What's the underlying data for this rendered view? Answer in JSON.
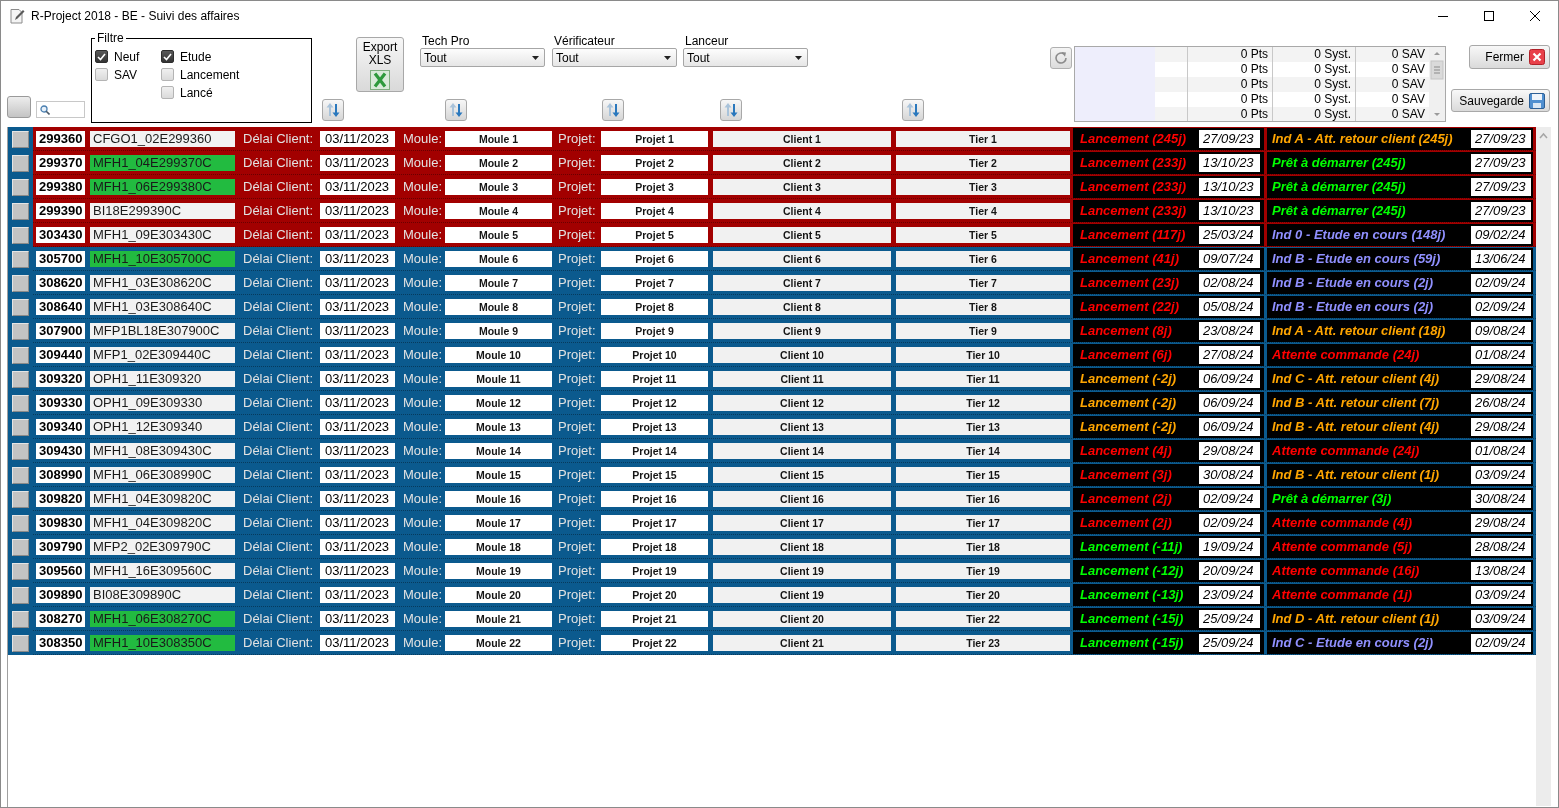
{
  "window": {
    "title": "R-Project 2018 - BE - Suivi des affaires"
  },
  "filter": {
    "title": "Filtre",
    "columns": [
      {
        "options": [
          {
            "label": "Neuf",
            "checked": true
          },
          {
            "label": "SAV",
            "checked": false
          }
        ]
      },
      {
        "options": [
          {
            "label": "Etude",
            "checked": true
          },
          {
            "label": "Lancement",
            "checked": false
          },
          {
            "label": "Lancé",
            "checked": false
          }
        ]
      }
    ]
  },
  "export_button": {
    "label": "Export XLS"
  },
  "dropdowns": [
    {
      "label": "Tech Pro",
      "value": "Tout"
    },
    {
      "label": "Vérificateur",
      "value": "Tout"
    },
    {
      "label": "Lanceur",
      "value": "Tout"
    }
  ],
  "summary": {
    "rows": [
      {
        "points": "0 Pts",
        "system": "0 Syst.",
        "sav": "0 SAV"
      },
      {
        "points": "0 Pts",
        "system": "0 Syst.",
        "sav": "0 SAV"
      },
      {
        "points": "0 Pts",
        "system": "0 Syst.",
        "sav": "0 SAV"
      },
      {
        "points": "0 Pts",
        "system": "0 Syst.",
        "sav": "0 SAV"
      },
      {
        "points": "0 Pts",
        "system": "0 Syst.",
        "sav": "0 SAV"
      }
    ]
  },
  "buttons": [
    {
      "kind": "close",
      "label": "Fermer"
    },
    {
      "kind": "save",
      "label": "Sauvegarde"
    }
  ],
  "rows": [
    {
      "id": "299360",
      "code": "CFGO1_02E299360",
      "code_marked": false,
      "flagged": true,
      "delai_label": "Délai Client:",
      "delai": "03/11/2023",
      "moule_label": "Moule:",
      "moule": "Moule 1",
      "projet_label": "Projet:",
      "projet": "Projet 1",
      "client": "Client 1",
      "tier": "Tier 1",
      "launch": {
        "text": "Lancement (245j)",
        "color": "#ff0000",
        "date": "27/09/23"
      },
      "status": {
        "text": "Ind A - Att. retour client (245j)",
        "color": "#ffa500",
        "date": "27/09/23"
      }
    },
    {
      "id": "299370",
      "code": "MFH1_04E299370C",
      "code_marked": true,
      "flagged": true,
      "delai_label": "Délai Client:",
      "delai": "03/11/2023",
      "moule_label": "Moule:",
      "moule": "Moule 2",
      "projet_label": "Projet:",
      "projet": "Projet 2",
      "client": "Client 2",
      "tier": "Tier 2",
      "launch": {
        "text": "Lancement (233j)",
        "color": "#ff0000",
        "date": "13/10/23"
      },
      "status": {
        "text": "Prêt à démarrer (245j)",
        "color": "#00ff00",
        "date": "27/09/23"
      }
    },
    {
      "id": "299380",
      "code": "MFH1_06E299380C",
      "code_marked": true,
      "flagged": true,
      "delai_label": "Délai Client:",
      "delai": "03/11/2023",
      "moule_label": "Moule:",
      "moule": "Moule 3",
      "projet_label": "Projet:",
      "projet": "Projet 3",
      "client": "Client 3",
      "tier": "Tier 3",
      "launch": {
        "text": "Lancement (233j)",
        "color": "#ff0000",
        "date": "13/10/23"
      },
      "status": {
        "text": "Prêt à démarrer (245j)",
        "color": "#00ff00",
        "date": "27/09/23"
      }
    },
    {
      "id": "299390",
      "code": "BI18E299390C",
      "code_marked": false,
      "flagged": true,
      "delai_label": "Délai Client:",
      "delai": "03/11/2023",
      "moule_label": "Moule:",
      "moule": "Moule 4",
      "projet_label": "Projet:",
      "projet": "Projet 4",
      "client": "Client 4",
      "tier": "Tier 4",
      "launch": {
        "text": "Lancement (233j)",
        "color": "#ff0000",
        "date": "13/10/23"
      },
      "status": {
        "text": "Prêt à démarrer (245j)",
        "color": "#00ff00",
        "date": "27/09/23"
      }
    },
    {
      "id": "303430",
      "code": "MFH1_09E303430C",
      "code_marked": false,
      "flagged": true,
      "delai_label": "Délai Client:",
      "delai": "03/11/2023",
      "moule_label": "Moule:",
      "moule": "Moule 5",
      "projet_label": "Projet:",
      "projet": "Projet 5",
      "client": "Client 5",
      "tier": "Tier 5",
      "launch": {
        "text": "Lancement (117j)",
        "color": "#ff0000",
        "date": "25/03/24"
      },
      "status": {
        "text": "Ind 0 - Etude en cours (148j)",
        "color": "#9090ff",
        "date": "09/02/24"
      }
    },
    {
      "id": "305700",
      "code": "MFH1_10E305700C",
      "code_marked": true,
      "flagged": false,
      "delai_label": "Délai Client:",
      "delai": "03/11/2023",
      "moule_label": "Moule:",
      "moule": "Moule 6",
      "projet_label": "Projet:",
      "projet": "Projet 6",
      "client": "Client 6",
      "tier": "Tier 6",
      "launch": {
        "text": "Lancement (41j)",
        "color": "#ff0000",
        "date": "09/07/24"
      },
      "status": {
        "text": "Ind B - Etude en cours (59j)",
        "color": "#9090ff",
        "date": "13/06/24"
      }
    },
    {
      "id": "308620",
      "code": "MFH1_03E308620C",
      "code_marked": false,
      "flagged": false,
      "delai_label": "Délai Client:",
      "delai": "03/11/2023",
      "moule_label": "Moule:",
      "moule": "Moule 7",
      "projet_label": "Projet:",
      "projet": "Projet 7",
      "client": "Client 7",
      "tier": "Tier 7",
      "launch": {
        "text": "Lancement (23j)",
        "color": "#ff0000",
        "date": "02/08/24"
      },
      "status": {
        "text": "Ind B - Etude en cours (2j)",
        "color": "#9090ff",
        "date": "02/09/24"
      }
    },
    {
      "id": "308640",
      "code": "MFH1_03E308640C",
      "code_marked": false,
      "flagged": false,
      "delai_label": "Délai Client:",
      "delai": "03/11/2023",
      "moule_label": "Moule:",
      "moule": "Moule 8",
      "projet_label": "Projet:",
      "projet": "Projet 8",
      "client": "Client 8",
      "tier": "Tier 8",
      "launch": {
        "text": "Lancement (22j)",
        "color": "#ff0000",
        "date": "05/08/24"
      },
      "status": {
        "text": "Ind B - Etude en cours (2j)",
        "color": "#9090ff",
        "date": "02/09/24"
      }
    },
    {
      "id": "307900",
      "code": "MFP1BL18E307900C",
      "code_marked": false,
      "flagged": false,
      "delai_label": "Délai Client:",
      "delai": "03/11/2023",
      "moule_label": "Moule:",
      "moule": "Moule 9",
      "projet_label": "Projet:",
      "projet": "Projet 9",
      "client": "Client 9",
      "tier": "Tier 9",
      "launch": {
        "text": "Lancement (8j)",
        "color": "#ff0000",
        "date": "23/08/24"
      },
      "status": {
        "text": "Ind A - Att. retour client (18j)",
        "color": "#ffa500",
        "date": "09/08/24"
      }
    },
    {
      "id": "309440",
      "code": "MFP1_02E309440C",
      "code_marked": false,
      "flagged": false,
      "delai_label": "Délai Client:",
      "delai": "03/11/2023",
      "moule_label": "Moule:",
      "moule": "Moule 10",
      "projet_label": "Projet:",
      "projet": "Projet 10",
      "client": "Client 10",
      "tier": "Tier 10",
      "launch": {
        "text": "Lancement (6j)",
        "color": "#ff0000",
        "date": "27/08/24"
      },
      "status": {
        "text": "Attente commande (24j)",
        "color": "#ff0000",
        "date": "01/08/24"
      }
    },
    {
      "id": "309320",
      "code": "OPH1_11E309320",
      "code_marked": false,
      "flagged": false,
      "delai_label": "Délai Client:",
      "delai": "03/11/2023",
      "moule_label": "Moule:",
      "moule": "Moule 11",
      "projet_label": "Projet:",
      "projet": "Projet 11",
      "client": "Client 11",
      "tier": "Tier 11",
      "launch": {
        "text": "Lancement (-2j)",
        "color": "#ffa500",
        "date": "06/09/24"
      },
      "status": {
        "text": "Ind C - Att. retour client (4j)",
        "color": "#ffa500",
        "date": "29/08/24"
      }
    },
    {
      "id": "309330",
      "code": "OPH1_09E309330",
      "code_marked": false,
      "flagged": false,
      "delai_label": "Délai Client:",
      "delai": "03/11/2023",
      "moule_label": "Moule:",
      "moule": "Moule 12",
      "projet_label": "Projet:",
      "projet": "Projet 12",
      "client": "Client 12",
      "tier": "Tier 12",
      "launch": {
        "text": "Lancement (-2j)",
        "color": "#ffa500",
        "date": "06/09/24"
      },
      "status": {
        "text": "Ind B - Att. retour client (7j)",
        "color": "#ffa500",
        "date": "26/08/24"
      }
    },
    {
      "id": "309340",
      "code": "OPH1_12E309340",
      "code_marked": false,
      "flagged": false,
      "delai_label": "Délai Client:",
      "delai": "03/11/2023",
      "moule_label": "Moule:",
      "moule": "Moule 13",
      "projet_label": "Projet:",
      "projet": "Projet 13",
      "client": "Client 13",
      "tier": "Tier 13",
      "launch": {
        "text": "Lancement (-2j)",
        "color": "#ffa500",
        "date": "06/09/24"
      },
      "status": {
        "text": "Ind B - Att. retour client (4j)",
        "color": "#ffa500",
        "date": "29/08/24"
      }
    },
    {
      "id": "309430",
      "code": "MFH1_08E309430C",
      "code_marked": false,
      "flagged": false,
      "delai_label": "Délai Client:",
      "delai": "03/11/2023",
      "moule_label": "Moule:",
      "moule": "Moule 14",
      "projet_label": "Projet:",
      "projet": "Projet 14",
      "client": "Client 14",
      "tier": "Tier 14",
      "launch": {
        "text": "Lancement (4j)",
        "color": "#ff0000",
        "date": "29/08/24"
      },
      "status": {
        "text": "Attente commande (24j)",
        "color": "#ff0000",
        "date": "01/08/24"
      }
    },
    {
      "id": "308990",
      "code": "MFH1_06E308990C",
      "code_marked": false,
      "flagged": false,
      "delai_label": "Délai Client:",
      "delai": "03/11/2023",
      "moule_label": "Moule:",
      "moule": "Moule 15",
      "projet_label": "Projet:",
      "projet": "Projet 15",
      "client": "Client 15",
      "tier": "Tier 15",
      "launch": {
        "text": "Lancement (3j)",
        "color": "#ff0000",
        "date": "30/08/24"
      },
      "status": {
        "text": "Ind B - Att. retour client (1j)",
        "color": "#ffa500",
        "date": "03/09/24"
      }
    },
    {
      "id": "309820",
      "code": "MFH1_04E309820C",
      "code_marked": false,
      "flagged": false,
      "delai_label": "Délai Client:",
      "delai": "03/11/2023",
      "moule_label": "Moule:",
      "moule": "Moule 16",
      "projet_label": "Projet:",
      "projet": "Projet 16",
      "client": "Client 16",
      "tier": "Tier 16",
      "launch": {
        "text": "Lancement (2j)",
        "color": "#ff0000",
        "date": "02/09/24"
      },
      "status": {
        "text": "Prêt à démarrer (3j)",
        "color": "#00ff00",
        "date": "30/08/24"
      }
    },
    {
      "id": "309830",
      "code": "MFH1_04E309820C",
      "code_marked": false,
      "flagged": false,
      "delai_label": "Délai Client:",
      "delai": "03/11/2023",
      "moule_label": "Moule:",
      "moule": "Moule 17",
      "projet_label": "Projet:",
      "projet": "Projet 17",
      "client": "Client 17",
      "tier": "Tier 17",
      "launch": {
        "text": "Lancement (2j)",
        "color": "#ff0000",
        "date": "02/09/24"
      },
      "status": {
        "text": "Attente commande (4j)",
        "color": "#ff0000",
        "date": "29/08/24"
      }
    },
    {
      "id": "309790",
      "code": "MFP2_02E309790C",
      "code_marked": false,
      "flagged": false,
      "delai_label": "Délai Client:",
      "delai": "03/11/2023",
      "moule_label": "Moule:",
      "moule": "Moule 18",
      "projet_label": "Projet:",
      "projet": "Projet 18",
      "client": "Client 18",
      "tier": "Tier 18",
      "launch": {
        "text": "Lancement (-11j)",
        "color": "#00ff00",
        "date": "19/09/24"
      },
      "status": {
        "text": "Attente commande (5j)",
        "color": "#ff0000",
        "date": "28/08/24"
      }
    },
    {
      "id": "309560",
      "code": "MFH1_16E309560C",
      "code_marked": false,
      "flagged": false,
      "delai_label": "Délai Client:",
      "delai": "03/11/2023",
      "moule_label": "Moule:",
      "moule": "Moule 19",
      "projet_label": "Projet:",
      "projet": "Projet 19",
      "client": "Client 19",
      "tier": "Tier 19",
      "launch": {
        "text": "Lancement (-12j)",
        "color": "#00ff00",
        "date": "20/09/24"
      },
      "status": {
        "text": "Attente commande (16j)",
        "color": "#ff0000",
        "date": "13/08/24"
      }
    },
    {
      "id": "309890",
      "code": "BI08E309890C",
      "code_marked": false,
      "flagged": false,
      "delai_label": "Délai Client:",
      "delai": "03/11/2023",
      "moule_label": "Moule:",
      "moule": "Moule 20",
      "projet_label": "Projet:",
      "projet": "Projet 20",
      "client": "Client 19",
      "tier": "Tier 20",
      "launch": {
        "text": "Lancement (-13j)",
        "color": "#00ff00",
        "date": "23/09/24"
      },
      "status": {
        "text": "Attente commande (1j)",
        "color": "#ff0000",
        "date": "03/09/24"
      }
    },
    {
      "id": "308270",
      "code": "MFH1_06E308270C",
      "code_marked": true,
      "flagged": false,
      "delai_label": "Délai Client:",
      "delai": "03/11/2023",
      "moule_label": "Moule:",
      "moule": "Moule 21",
      "projet_label": "Projet:",
      "projet": "Projet 21",
      "client": "Client 20",
      "tier": "Tier 22",
      "launch": {
        "text": "Lancement (-15j)",
        "color": "#00ff00",
        "date": "25/09/24"
      },
      "status": {
        "text": "Ind D - Att. retour client (1j)",
        "color": "#ffa500",
        "date": "03/09/24"
      }
    },
    {
      "id": "308350",
      "code": "MFH1_10E308350C",
      "code_marked": true,
      "flagged": false,
      "delai_label": "Délai Client:",
      "delai": "03/11/2023",
      "moule_label": "Moule:",
      "moule": "Moule 22",
      "projet_label": "Projet:",
      "projet": "Projet 22",
      "client": "Client 21",
      "tier": "Tier 23",
      "launch": {
        "text": "Lancement (-15j)",
        "color": "#00ff00",
        "date": "25/09/24"
      },
      "status": {
        "text": "Ind C - Etude en cours (2j)",
        "color": "#9090ff",
        "date": "02/09/24"
      }
    }
  ]
}
